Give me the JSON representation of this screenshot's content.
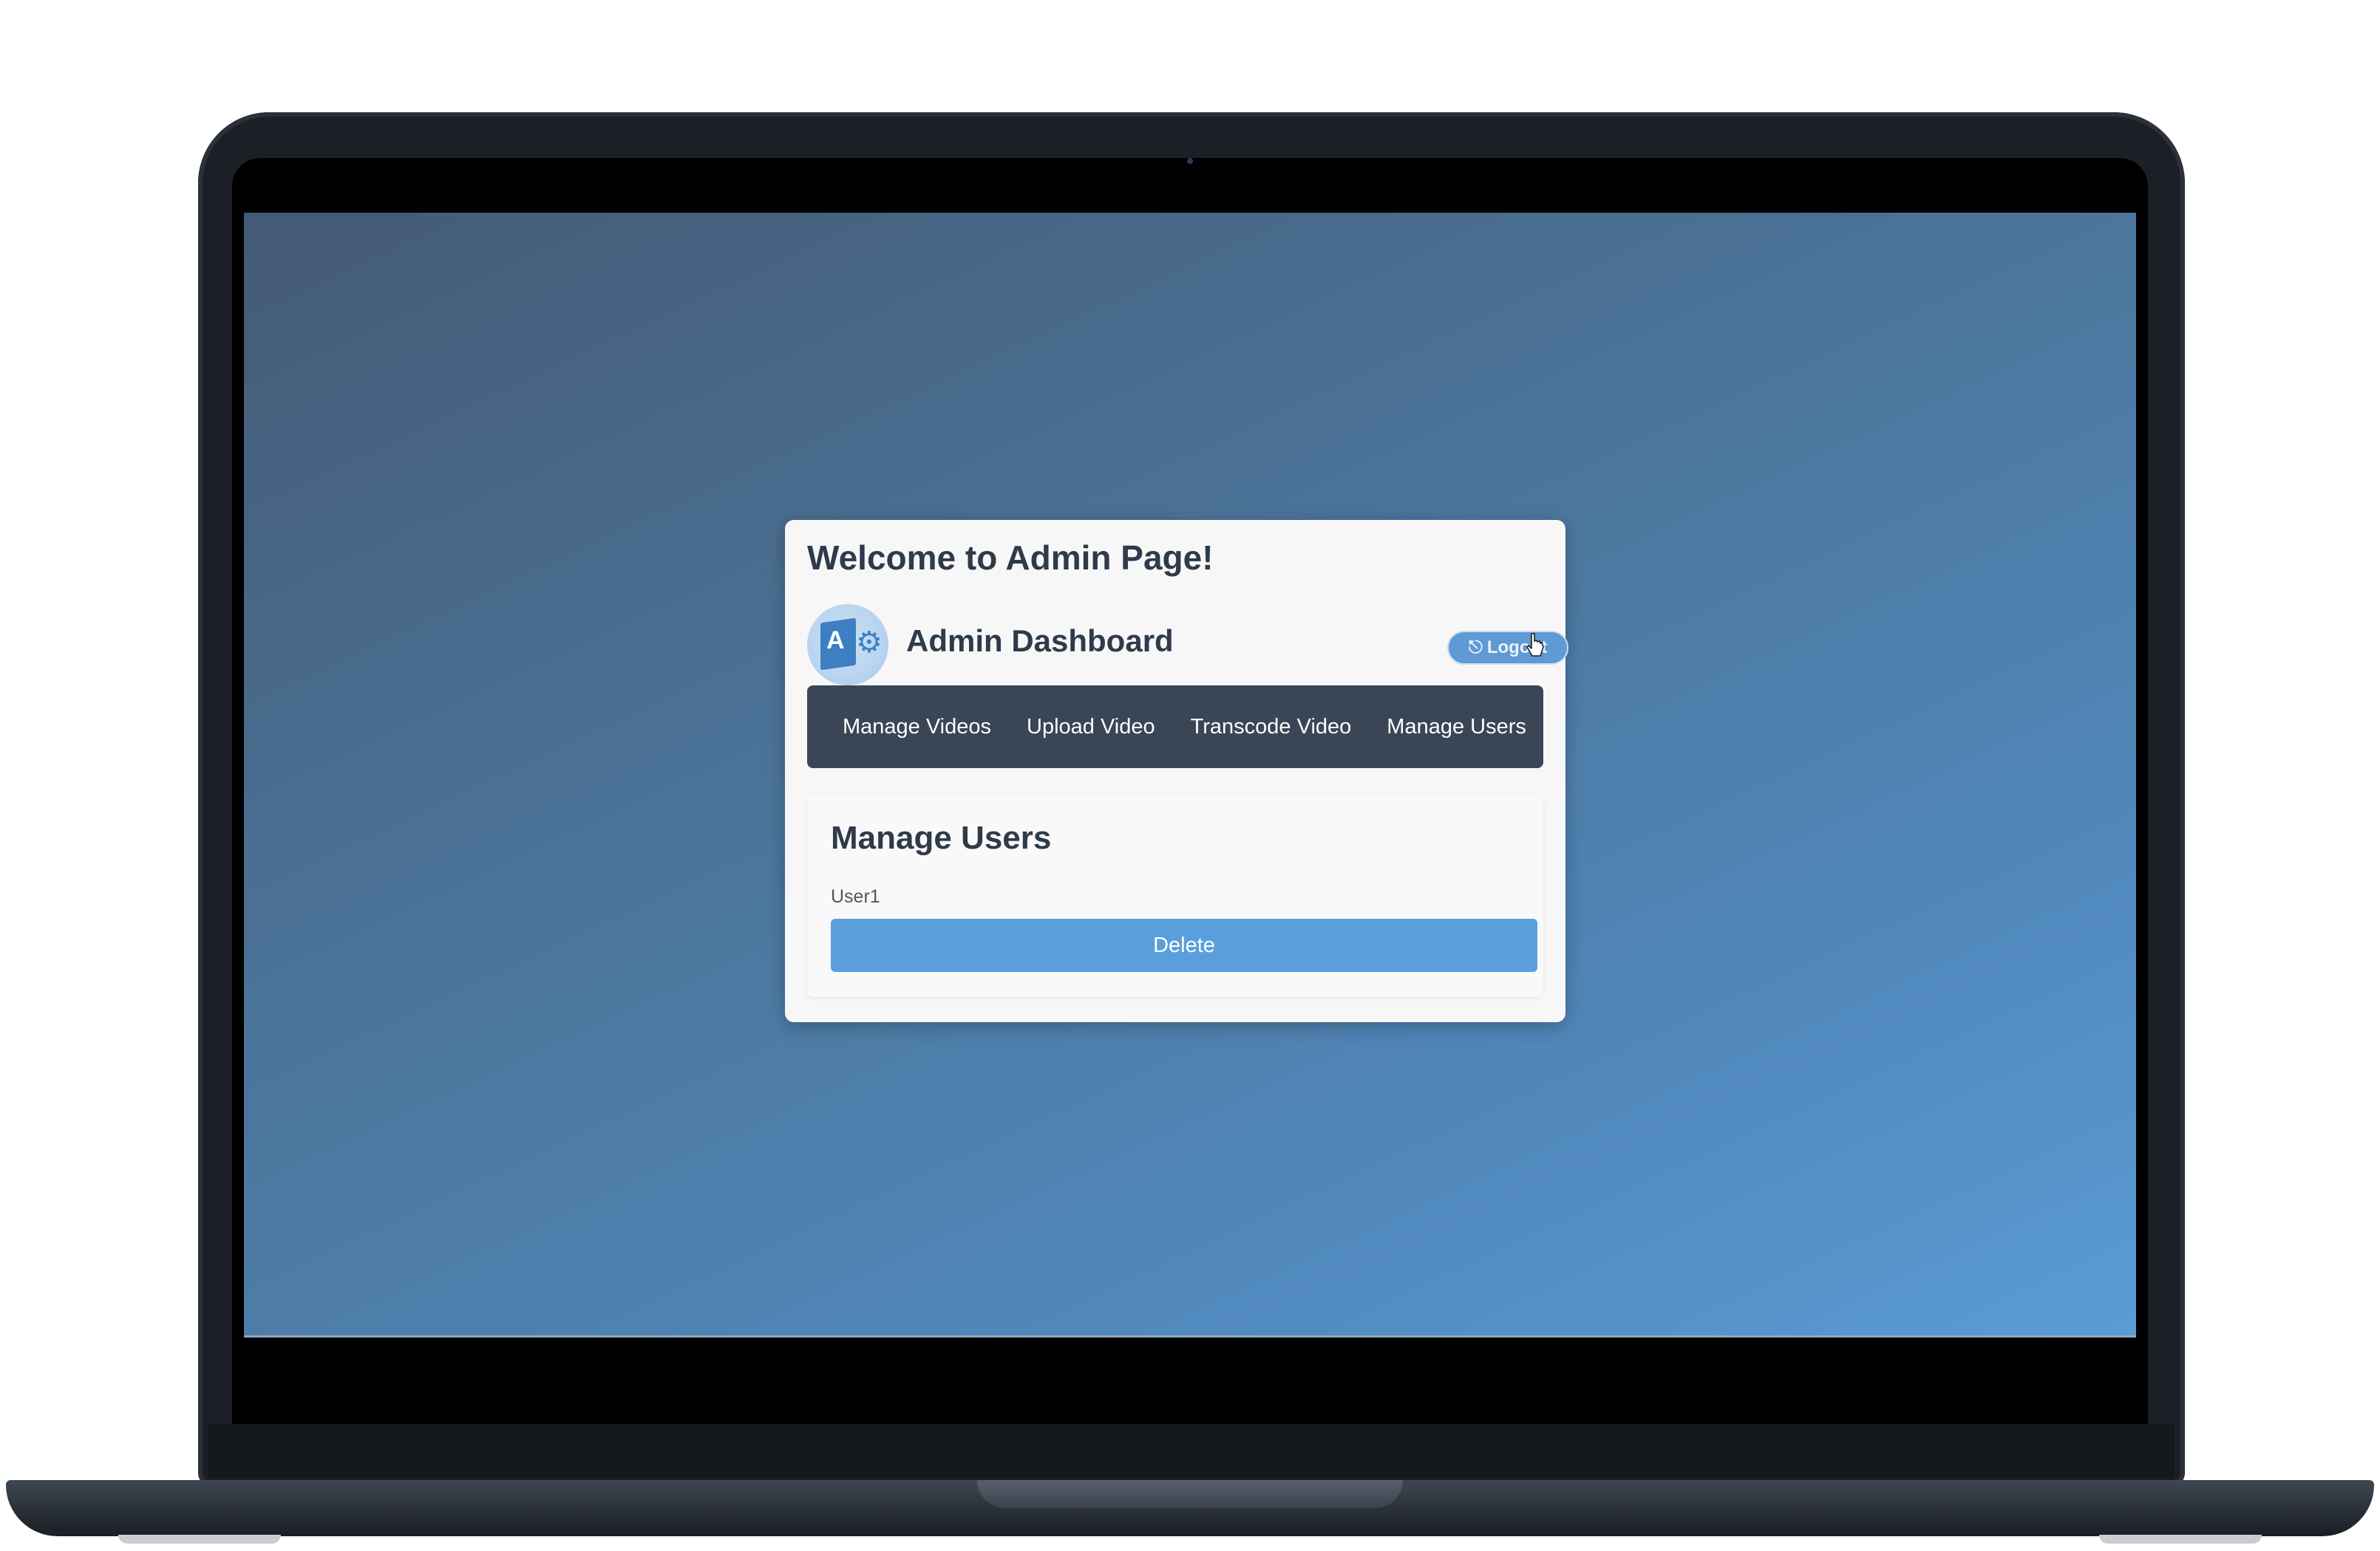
{
  "page": {
    "welcome_title": "Welcome to Admin Page!",
    "dashboard_title": "Admin Dashboard",
    "logo_letter": "A",
    "logout_label": "Logout"
  },
  "nav": {
    "items": [
      {
        "label": "Manage Videos"
      },
      {
        "label": "Upload Video"
      },
      {
        "label": "Transcode Video"
      },
      {
        "label": "Manage Users"
      }
    ]
  },
  "manage_users": {
    "title": "Manage Users",
    "users": [
      {
        "name": "User1",
        "action_label": "Delete"
      }
    ]
  },
  "colors": {
    "background_gradient_start": "#445a75",
    "background_gradient_end": "#5b9bd6",
    "nav_background": "#3a4555",
    "accent_button": "#5a9fdc"
  },
  "icons": [
    "logo-icon",
    "logout-icon",
    "mouse-cursor-icon",
    "gear-icon"
  ]
}
